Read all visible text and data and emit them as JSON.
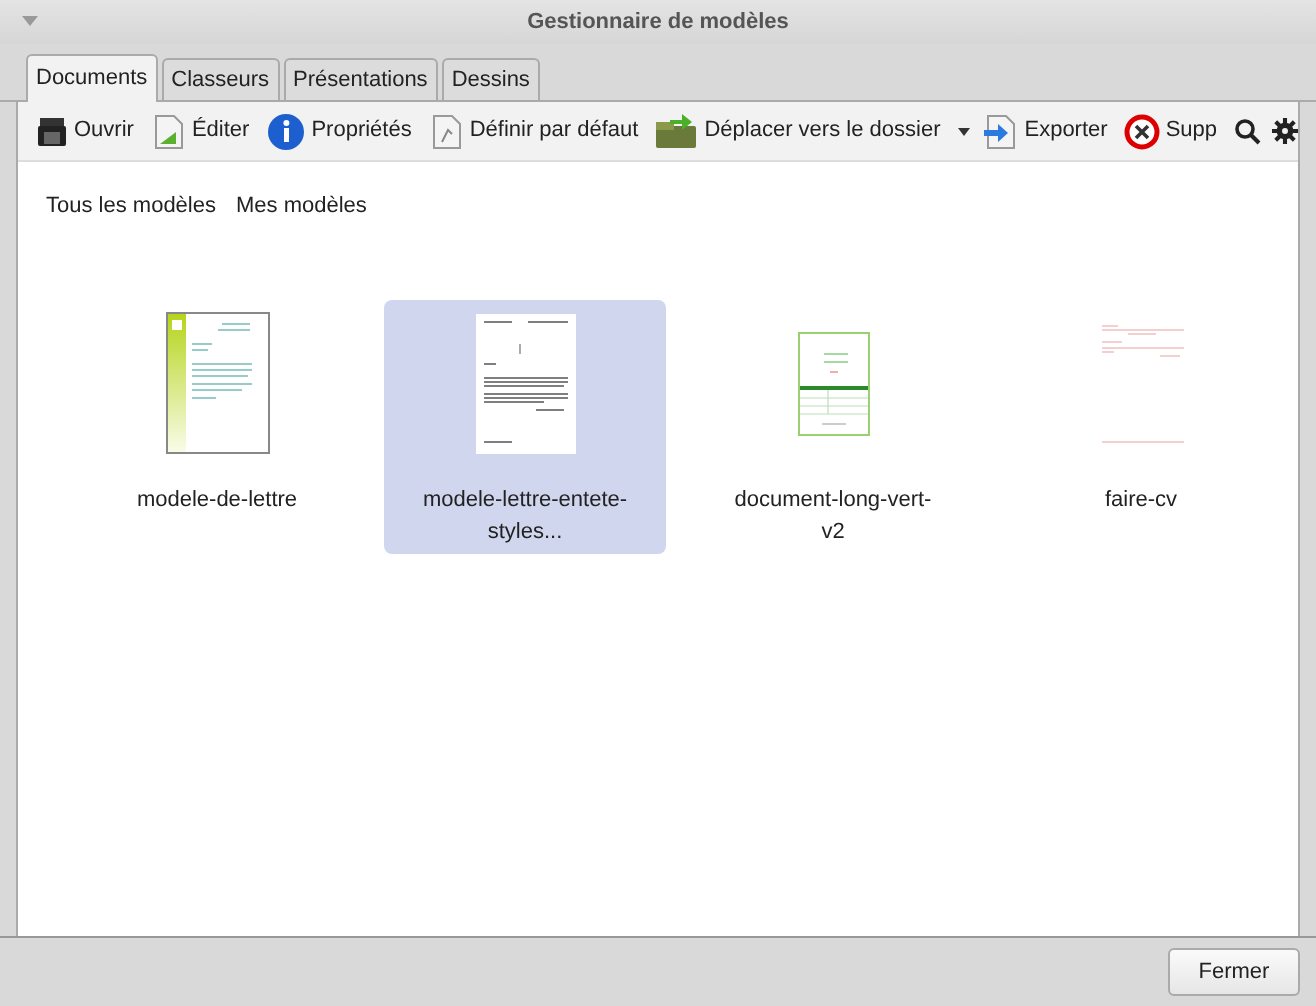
{
  "window": {
    "title": "Gestionnaire de modèles"
  },
  "tabs": [
    {
      "label": "Documents",
      "selected": true
    },
    {
      "label": "Classeurs",
      "selected": false
    },
    {
      "label": "Présentations",
      "selected": false
    },
    {
      "label": "Dessins",
      "selected": false
    }
  ],
  "toolbar": [
    {
      "kind": "open",
      "label": "Ouvrir"
    },
    {
      "kind": "edit",
      "label": "Éditer"
    },
    {
      "kind": "info",
      "label": "Propriétés"
    },
    {
      "kind": "default",
      "label": "Définir par défaut"
    },
    {
      "kind": "move",
      "label": "Déplacer vers le dossier"
    },
    {
      "kind": "caret"
    },
    {
      "kind": "export",
      "label": "Exporter"
    },
    {
      "kind": "delete",
      "label": "Supp"
    },
    {
      "kind": "search"
    },
    {
      "kind": "gear"
    }
  ],
  "filters": [
    {
      "label": "Tous les modèles"
    },
    {
      "label": "Mes modèles"
    }
  ],
  "templates": [
    {
      "name": "modele-de-lettre",
      "kind": "letter-green",
      "selected": false
    },
    {
      "name": "modele-lettre-entete-styles...",
      "kind": "letter-plain",
      "selected": true
    },
    {
      "name": "document-long-vert-v2",
      "kind": "table-green",
      "selected": false
    },
    {
      "name": "faire-cv",
      "kind": "cv-red",
      "selected": false
    }
  ],
  "buttons": [
    {
      "label": "Fermer"
    }
  ]
}
